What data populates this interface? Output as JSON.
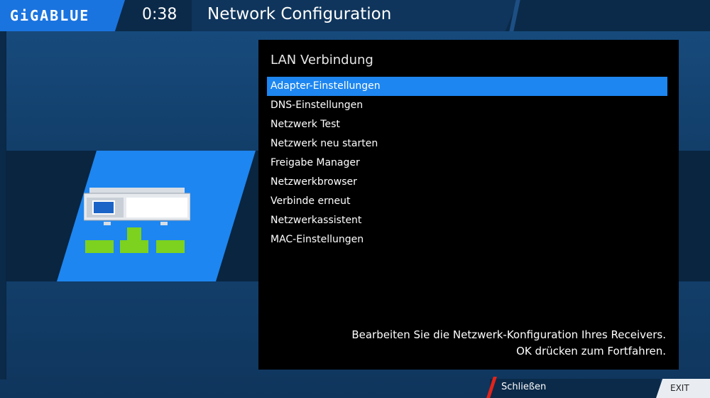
{
  "header": {
    "logo_text": "GiGABLUE",
    "clock": "0:38",
    "title": "Network Configuration"
  },
  "icon": {
    "name": "network-device-icon"
  },
  "menu": {
    "heading": "LAN Verbindung",
    "selected_index": 0,
    "items": [
      {
        "label": "Adapter-Einstellungen"
      },
      {
        "label": "DNS-Einstellungen"
      },
      {
        "label": "Netzwerk Test"
      },
      {
        "label": "Netzwerk neu starten"
      },
      {
        "label": "Freigabe Manager"
      },
      {
        "label": "Netzwerkbrowser"
      },
      {
        "label": "Verbinde erneut"
      },
      {
        "label": "Netzwerkassistent"
      },
      {
        "label": "MAC-Einstellungen"
      }
    ],
    "description_line1": "Bearbeiten Sie die Netzwerk-Konfiguration Ihres Receivers.",
    "description_line2": "OK drücken zum Fortfahren."
  },
  "footer": {
    "close_label": "Schließen",
    "exit_label": "EXIT"
  },
  "colors": {
    "accent": "#1d86f0",
    "background": "#0c2f52",
    "red_key": "#e2231a",
    "green_icon": "#7cd21e"
  }
}
